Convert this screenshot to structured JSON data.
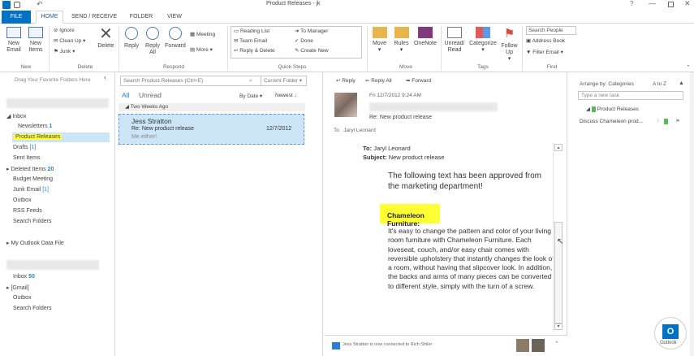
{
  "window": {
    "title": "Product Releases - jk"
  },
  "tabs": [
    {
      "label": "FILE"
    },
    {
      "label": "HOME"
    },
    {
      "label": "SEND / RECEIVE"
    },
    {
      "label": "FOLDER"
    },
    {
      "label": "VIEW"
    }
  ],
  "ribbon": {
    "new_email": "New Email",
    "new_items": "New Items",
    "ignore": "Ignore",
    "cleanup": "Clean Up",
    "junk": "Junk",
    "delete": "Delete",
    "reply": "Reply",
    "reply_all": "Reply All",
    "forward": "Forward",
    "meeting": "Meeting",
    "more": "More",
    "qs_reading_list": "Reading List",
    "qs_team_email": "Team Email",
    "qs_reply_delete": "Reply & Delete",
    "qs_to_manager": "To Manager",
    "qs_done": "Done",
    "qs_create_new": "Create New",
    "move": "Move",
    "rules": "Rules",
    "onenote": "OneNote",
    "unread_read": "Unread/ Read",
    "categorize": "Categorize",
    "follow_up": "Follow Up",
    "search_people": "Search People",
    "address_book": "Address Book",
    "filter_email": "Filter Email",
    "groups": {
      "new": "New",
      "delete": "Delete",
      "respond": "Respond",
      "quick_steps": "Quick Steps",
      "move": "Move",
      "tags": "Tags",
      "find": "Find"
    }
  },
  "nav": {
    "favorites_hint": "Drag Your Favorite Folders Here",
    "inbox": "Inbox",
    "newsletters": "Newsletters",
    "newsletters_count": "1",
    "product_releases": "Product Releases",
    "drafts": "Drafts",
    "drafts_count": "[1]",
    "sent_items": "Sent Items",
    "deleted_items": "Deleted Items",
    "deleted_count": "20",
    "budget_meeting": "Budget Meeting",
    "junk_email": "Junk Email",
    "junk_count": "[1]",
    "outbox": "Outbox",
    "rss_feeds": "RSS Feeds",
    "search_folders": "Search Folders",
    "my_outlook_data_file": "My Outlook Data File",
    "inbox2": "Inbox",
    "inbox2_count": "50",
    "gmail": "[Gmail]",
    "outbox2": "Outbox",
    "search_folders2": "Search Folders"
  },
  "list": {
    "search_placeholder": "Search Product Releases (Ctrl+E)",
    "scope": "Current Folder",
    "filter_all": "All",
    "filter_unread": "Unread",
    "sort_by": "By Date",
    "sort_order": "Newest",
    "group_header": "Two Weeks Ago",
    "items": [
      {
        "sender": "Jess Stratton",
        "subject": "Re: New product release",
        "date": "12/7/2012",
        "preview": "Me either!"
      }
    ]
  },
  "reading": {
    "reply": "Reply",
    "reply_all": "Reply All",
    "forward": "Forward",
    "sent_date": "Fri 12/7/2012 9:24 AM",
    "subject": "Re: New product release",
    "to_label": "To",
    "to_value": "Jaryl Leonard",
    "quoted_to_label": "To:",
    "quoted_to": "Jaryl Leonard",
    "quoted_subject_label": "Subject:",
    "quoted_subject": "New product release",
    "intro": "The following text has been approved from the marketing department!",
    "heading": "Chameleon Furniture:",
    "paragraph": "It's easy to change the pattern and color of your living room furniture with Chameleon Furniture. Each loveseat, couch, and/or easy chair comes with reversible upholstery that instantly changes the look of a room, without having that slipcover look. In addition, the backs and arms of many pieces can be converted to different style, simply with the turn of a screw.",
    "people_status": "Jess Stratton is now connected to Rich Shiler"
  },
  "todo": {
    "arrange_by": "Arrange by: Categories",
    "sort": "A to Z",
    "new_task_placeholder": "Type a new task",
    "category": "Product Releases",
    "task": "Discuss Chameleon prod..."
  },
  "watermark": {
    "text": "Outlook"
  },
  "colors": {
    "accent": "#0072c6",
    "highlight": "#ffff33",
    "selected": "#cde6f7",
    "count": "#2b7fd3"
  }
}
